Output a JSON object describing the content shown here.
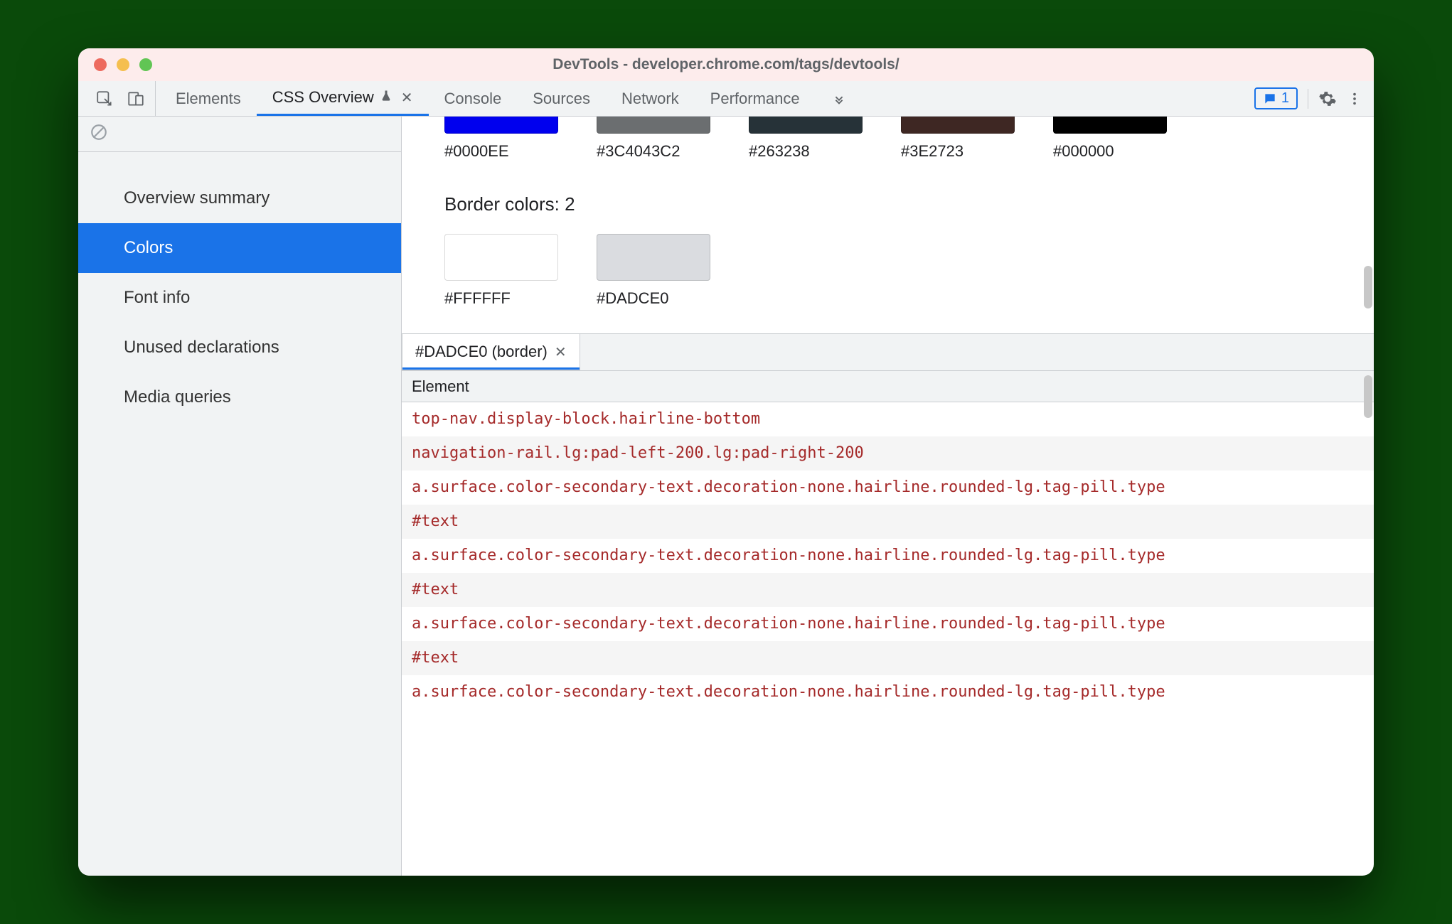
{
  "window": {
    "title": "DevTools - developer.chrome.com/tags/devtools/"
  },
  "toolbar": {
    "tabs": [
      {
        "label": "Elements"
      },
      {
        "label": "CSS Overview"
      },
      {
        "label": "Console"
      },
      {
        "label": "Sources"
      },
      {
        "label": "Network"
      },
      {
        "label": "Performance"
      }
    ],
    "message_count": "1"
  },
  "sidebar": {
    "items": [
      {
        "label": "Overview summary"
      },
      {
        "label": "Colors"
      },
      {
        "label": "Font info"
      },
      {
        "label": "Unused declarations"
      },
      {
        "label": "Media queries"
      }
    ]
  },
  "colors": {
    "row1": [
      {
        "hex": "#0000EE",
        "label": "#0000EE"
      },
      {
        "hex": "#3c4043",
        "label": "#3C4043C2",
        "alpha": "0.76"
      },
      {
        "hex": "#263238",
        "label": "#263238"
      },
      {
        "hex": "#3e2723",
        "label": "#3E2723"
      },
      {
        "hex": "#000000",
        "label": "#000000"
      }
    ],
    "border_title": "Border colors: 2",
    "border_row": [
      {
        "hex": "#FFFFFF",
        "label": "#FFFFFF"
      },
      {
        "hex": "#DADCE0",
        "label": "#DADCE0"
      }
    ]
  },
  "details": {
    "tab_label": "#DADCE0 (border)",
    "header": "Element",
    "rows": [
      "top-nav.display-block.hairline-bottom",
      "navigation-rail.lg:pad-left-200.lg:pad-right-200",
      "a.surface.color-secondary-text.decoration-none.hairline.rounded-lg.tag-pill.type",
      "#text",
      "a.surface.color-secondary-text.decoration-none.hairline.rounded-lg.tag-pill.type",
      "#text",
      "a.surface.color-secondary-text.decoration-none.hairline.rounded-lg.tag-pill.type",
      "#text",
      "a.surface.color-secondary-text.decoration-none.hairline.rounded-lg.tag-pill.type"
    ]
  }
}
